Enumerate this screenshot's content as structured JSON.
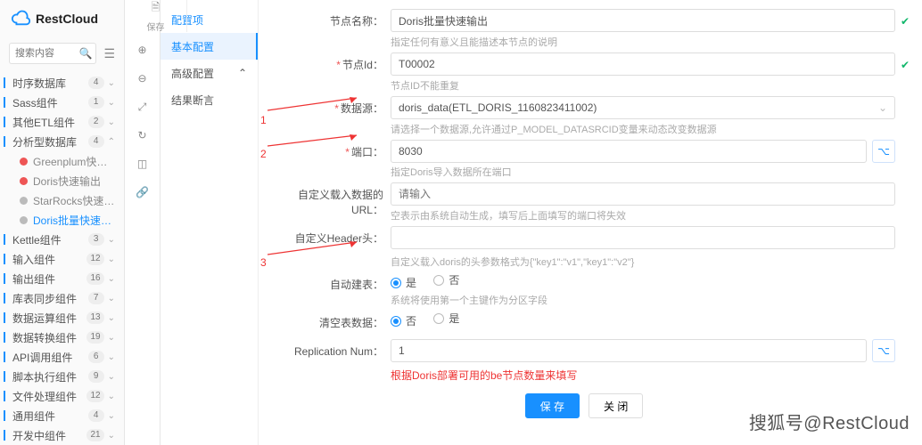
{
  "brand": "RestCloud",
  "save_label": "保存",
  "search_placeholder": "搜索内容",
  "tree": [
    {
      "label": "时序数据库",
      "count": "4",
      "bar": true
    },
    {
      "label": "Sass组件",
      "count": "1",
      "bar": true
    },
    {
      "label": "其他ETL组件",
      "count": "2",
      "bar": true
    },
    {
      "label": "分析型数据库",
      "count": "4",
      "bar": true,
      "expanded": true
    },
    {
      "label": "Greenplum快速输出",
      "child": true,
      "dot": "red"
    },
    {
      "label": "Doris快速输出",
      "child": true,
      "dot": "red"
    },
    {
      "label": "StarRocks快速输出",
      "child": true,
      "dot": "grey"
    },
    {
      "label": "Doris批量快速输出",
      "child": true,
      "dot": "grey",
      "sel": true
    },
    {
      "label": "Kettle组件",
      "count": "3",
      "bar": true
    },
    {
      "label": "输入组件",
      "count": "12",
      "bar": true
    },
    {
      "label": "输出组件",
      "count": "16",
      "bar": true
    },
    {
      "label": "库表同步组件",
      "count": "7",
      "bar": true
    },
    {
      "label": "数据运算组件",
      "count": "13",
      "bar": true
    },
    {
      "label": "数据转换组件",
      "count": "19",
      "bar": true
    },
    {
      "label": "API调用组件",
      "count": "6",
      "bar": true
    },
    {
      "label": "脚本执行组件",
      "count": "9",
      "bar": true
    },
    {
      "label": "文件处理组件",
      "count": "12",
      "bar": true
    },
    {
      "label": "通用组件",
      "count": "4",
      "bar": true
    },
    {
      "label": "开发中组件",
      "count": "21",
      "bar": true
    }
  ],
  "tabs": {
    "title": "配置项",
    "basic": "基本配置",
    "adv": "高级配置",
    "assert": "结果断言"
  },
  "form": {
    "nodeName": {
      "label": "节点名称",
      "value": "Doris批量快速输出",
      "hint": "指定任何有意义且能描述本节点的说明"
    },
    "nodeId": {
      "label": "节点Id",
      "value": "T00002",
      "hint": "节点ID不能重复"
    },
    "ds": {
      "label": "数据源",
      "value": "doris_data(ETL_DORIS_1160823411002)",
      "hint": "请选择一个数据源,允许通过P_MODEL_DATASRCID变量来动态改变数据源"
    },
    "port": {
      "label": "端口",
      "value": "8030",
      "hint": "指定Doris导入数据所在端口"
    },
    "url": {
      "label": "自定义载入数据的URL",
      "placeholder": "请输入",
      "hint": "空表示由系统自动生成，填写后上面填写的端口将失效"
    },
    "header": {
      "label": "自定义Header头",
      "hint": "自定义载入doris的头参数格式为{\"key1\":\"v1\",\"key1\":\"v2\"}"
    },
    "auto": {
      "label": "自动建表",
      "yes": "是",
      "no": "否",
      "hint": "系统将使用第一个主键作为分区字段"
    },
    "clear": {
      "label": "清空表数据",
      "yes": "是",
      "no": "否"
    },
    "rep": {
      "label": "Replication Num",
      "value": "1"
    }
  },
  "marks": {
    "m1": "1",
    "m2": "2",
    "m3": "3"
  },
  "note": "根据Doris部署可用的be节点数量来填写",
  "buttons": {
    "save": "保 存",
    "close": "关 闭"
  },
  "watermark": "搜狐号@RestCloud"
}
